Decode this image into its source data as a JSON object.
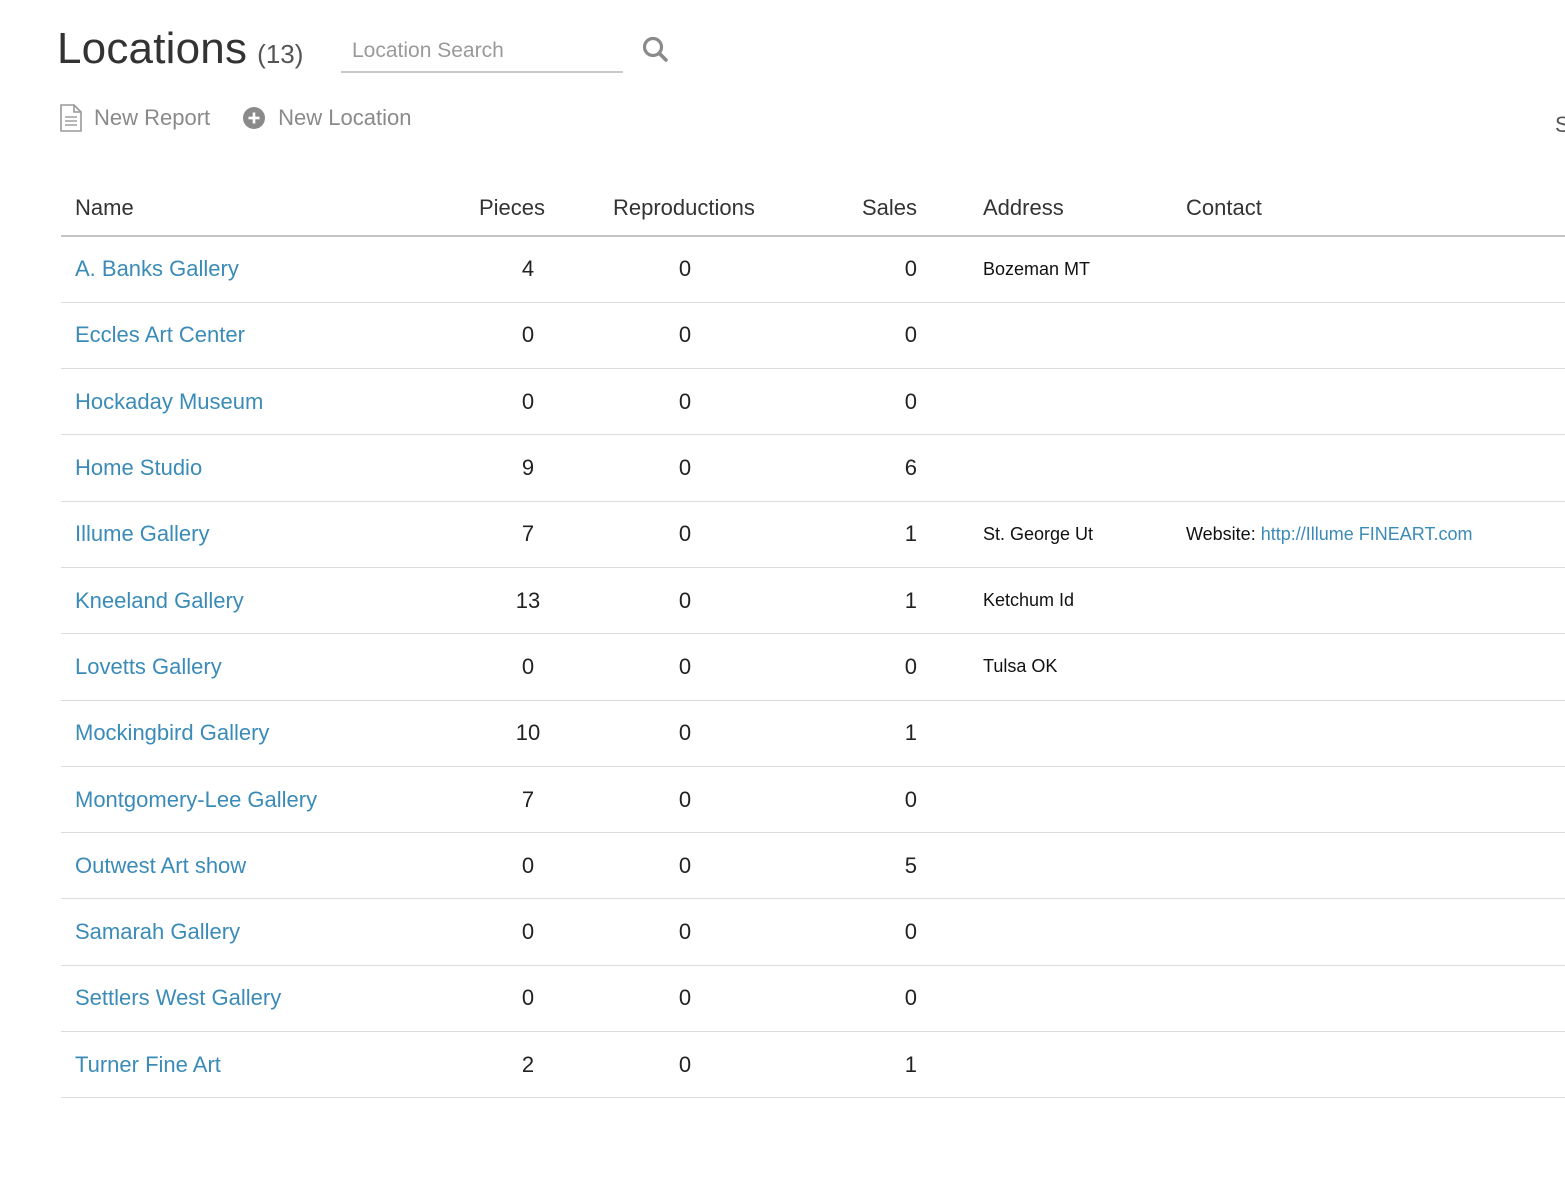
{
  "header": {
    "title": "Locations",
    "count": "(13)"
  },
  "search": {
    "placeholder": "Location Search",
    "value": ""
  },
  "actions": {
    "new_report": "New Report",
    "new_location": "New Location"
  },
  "edge_text": "S",
  "table": {
    "columns": [
      "Name",
      "Pieces",
      "Reproductions",
      "Sales",
      "Address",
      "Contact"
    ],
    "rows": [
      {
        "name": "A. Banks Gallery",
        "pieces": "4",
        "reproductions": "0",
        "sales": "0",
        "address": "Bozeman MT",
        "contact_label": "",
        "contact_link": ""
      },
      {
        "name": "Eccles Art Center",
        "pieces": "0",
        "reproductions": "0",
        "sales": "0",
        "address": "",
        "contact_label": "",
        "contact_link": ""
      },
      {
        "name": "Hockaday Museum",
        "pieces": "0",
        "reproductions": "0",
        "sales": "0",
        "address": "",
        "contact_label": "",
        "contact_link": ""
      },
      {
        "name": "Home Studio",
        "pieces": "9",
        "reproductions": "0",
        "sales": "6",
        "address": "",
        "contact_label": "",
        "contact_link": ""
      },
      {
        "name": "Illume Gallery",
        "pieces": "7",
        "reproductions": "0",
        "sales": "1",
        "address": "St. George Ut",
        "contact_label": "Website:",
        "contact_link": "http://Illume FINEART.com"
      },
      {
        "name": "Kneeland Gallery",
        "pieces": "13",
        "reproductions": "0",
        "sales": "1",
        "address": "Ketchum Id",
        "contact_label": "",
        "contact_link": ""
      },
      {
        "name": "Lovetts Gallery",
        "pieces": "0",
        "reproductions": "0",
        "sales": "0",
        "address": "Tulsa OK",
        "contact_label": "",
        "contact_link": ""
      },
      {
        "name": "Mockingbird Gallery",
        "pieces": "10",
        "reproductions": "0",
        "sales": "1",
        "address": "",
        "contact_label": "",
        "contact_link": ""
      },
      {
        "name": "Montgomery-Lee Gallery",
        "pieces": "7",
        "reproductions": "0",
        "sales": "0",
        "address": "",
        "contact_label": "",
        "contact_link": ""
      },
      {
        "name": "Outwest Art show",
        "pieces": "0",
        "reproductions": "0",
        "sales": "5",
        "address": "",
        "contact_label": "",
        "contact_link": ""
      },
      {
        "name": "Samarah Gallery",
        "pieces": "0",
        "reproductions": "0",
        "sales": "0",
        "address": "",
        "contact_label": "",
        "contact_link": ""
      },
      {
        "name": "Settlers West Gallery",
        "pieces": "0",
        "reproductions": "0",
        "sales": "0",
        "address": "",
        "contact_label": "",
        "contact_link": ""
      },
      {
        "name": "Turner Fine Art",
        "pieces": "2",
        "reproductions": "0",
        "sales": "1",
        "address": "",
        "contact_label": "",
        "contact_link": ""
      }
    ]
  },
  "icons": {
    "search": "search-icon",
    "report": "document-icon",
    "add": "plus-circle-icon"
  },
  "colors": {
    "link": "#3b8bb8",
    "muted": "#8a8a8a"
  }
}
